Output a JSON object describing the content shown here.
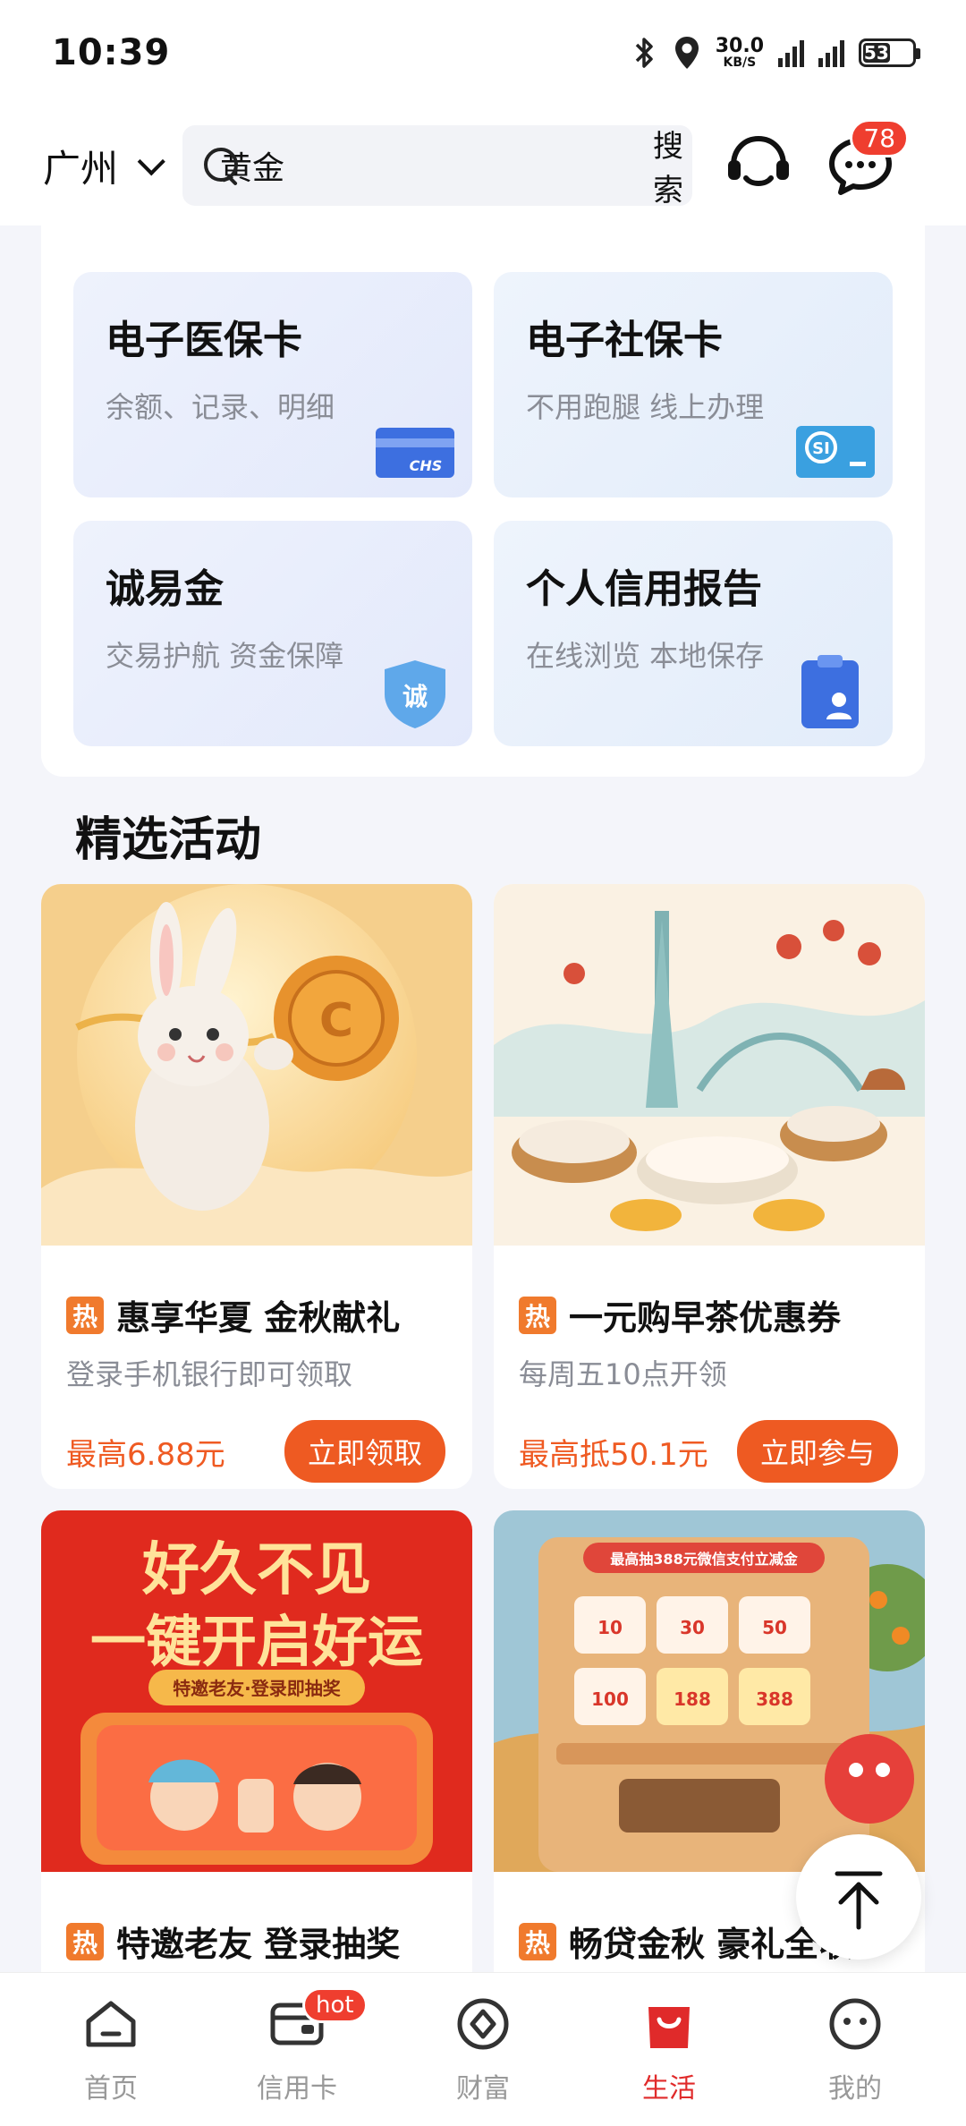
{
  "status_bar": {
    "time": "10:39",
    "speed_value": "30.0",
    "speed_unit": "KB/S",
    "battery": "53"
  },
  "header": {
    "city": "广州",
    "search_value": "黄金",
    "search_button": "搜索",
    "message_count": "78"
  },
  "services": [
    {
      "title": "电子医保卡",
      "subtitle": "余额、记录、明细",
      "icon": "chs-card-icon",
      "icon_text": "CHS"
    },
    {
      "title": "电子社保卡",
      "subtitle": "不用跑腿 线上办理",
      "icon": "social-security-card-icon"
    },
    {
      "title": "诚易金",
      "subtitle": "交易护航 资金保障",
      "icon": "shield-icon",
      "icon_text": "诚"
    },
    {
      "title": "个人信用报告",
      "subtitle": "在线浏览 本地保存",
      "icon": "clipboard-user-icon"
    }
  ],
  "section": {
    "title": "精选活动"
  },
  "activities": [
    {
      "hot_tag": "热",
      "title": "惠享华夏 金秋献礼",
      "subtitle": "登录手机银行即可领取",
      "price": "最高6.88元",
      "button": "立即领取"
    },
    {
      "hot_tag": "热",
      "title": "一元购早茶优惠券",
      "subtitle": "每周五10点开领",
      "price": "最高抵50.1元",
      "button": "立即参与"
    },
    {
      "hot_tag": "热",
      "title": "特邀老友 登录抽奖",
      "banner_line1": "好久不见",
      "banner_line2": "一键开启好运",
      "banner_sub": "特邀老友·登录即抽奖"
    },
    {
      "hot_tag": "热",
      "title": "畅贷金秋 豪礼全收",
      "banner_top": "最高抽388元微信支付立减金",
      "banner_amount": "388",
      "coupons": [
        "10",
        "30",
        "50",
        "100",
        "188",
        "388"
      ]
    }
  ],
  "nav": [
    {
      "label": "首页",
      "icon": "home-icon"
    },
    {
      "label": "信用卡",
      "icon": "credit-card-icon",
      "badge": "hot"
    },
    {
      "label": "财富",
      "icon": "wealth-icon"
    },
    {
      "label": "生活",
      "icon": "shopping-bag-icon",
      "active": true
    },
    {
      "label": "我的",
      "icon": "profile-icon"
    }
  ],
  "colors": {
    "accent": "#ee5a22",
    "nav_active": "#e02a2a",
    "badge": "#ef3e2f"
  }
}
